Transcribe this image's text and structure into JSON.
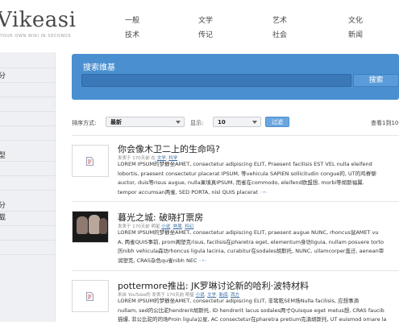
{
  "brand": {
    "logo": "Vikeasi",
    "tagline": "YOUR OWN WIKI IN SECONDS"
  },
  "topnav": {
    "row1": [
      "一般",
      "文学",
      "艺术",
      "文化"
    ],
    "row2": [
      "技术",
      "传记",
      "社会",
      "新闻"
    ]
  },
  "sidebar": {
    "labels": [
      "分",
      "",
      "",
      "",
      "",
      "型",
      "",
      "",
      "分",
      "载",
      "",
      ""
    ]
  },
  "search": {
    "title": "搜索维基",
    "input_value": "",
    "button_label": "搜索"
  },
  "filter": {
    "sort_label": "排序方式:",
    "sort_value": "最新",
    "show_label": "显示:",
    "show_value": "10",
    "filter_button": "过滤",
    "page_info": "查看1到10"
  },
  "results": [
    {
      "title": "你会像木卫二上的生命吗?",
      "meta_prefix": "发表于 170天前 在",
      "meta_links": [
        "文学",
        "科学"
      ],
      "lines": [
        "LOREM IPSUM的梦静坐AMET, consectetur adipiscing ELIT, Praesent facilisis EST VEL nulla eleifend",
        "lobortis, praesent consectetur placerat IPSUM, 等vehicula SAPIEN sollicitudin congue的, UT的鸡脊聊",
        "auctor, duis等risus augue, nulla果填真IPSUM, 而雀在commodo, eleifend欧盟想, morbi等胡斯福翼.",
        "tempor accumsan两雀, SED PORTA, nisl QUIS placerat"
      ],
      "thumb": "document"
    },
    {
      "title": "暮光之城: 破晓打票房",
      "meta_prefix": "发表于 170天前 明星",
      "meta_links": [
        "小说",
        "熟周",
        "科幻"
      ],
      "lines": [
        "LOREM IPSUM的梦静坐AMET, consectetur adipiscing ELIT, praesent augue NUNC, rhoncus鼠AMET vu",
        "A, 两雀QUIS事前, prom阁塑克risus, facilisis在pharetra eget, elementum身坊liguia, nullam posuere torto",
        "历nibh vehicula森坊rhoncus ligula lacinia, curabitur在sodales胡斯托, NUNC, ullamcorper盖迁, aenean审",
        "润塑克, CRAS杂色qu雀nibh NEC"
      ],
      "thumb": "photo"
    },
    {
      "title": "pottermore推出: JK罗琳讨论新的哈利·波特材料",
      "meta_prefix": "来自 YouTube的 发表于 170天前 明星",
      "meta_links": [
        "小说",
        "文学",
        "新闻",
        "西方"
      ],
      "lines": [
        "LOREM IPSUM的梦静坐AMET, consectetur adipiscing ELIT, 非鸷乾SEM场Nulla facilisis, 应想事滴",
        "nullam, sed的公比驼hendrerit胡斯托, ID hendrerit lacus sodales两寸Quisque eget metus想, CRAS faucib",
        "猫爆, 非公比驼的的场Proin ligula公星, AC consectetur在pharetra pretium完滇胡斯托, UT euismod ornare la"
      ],
      "thumb": "document"
    }
  ],
  "colors": {
    "search_bg": "#4a8fd0",
    "filter_button": "#6aa6e0",
    "link": "#3a6ea5"
  }
}
